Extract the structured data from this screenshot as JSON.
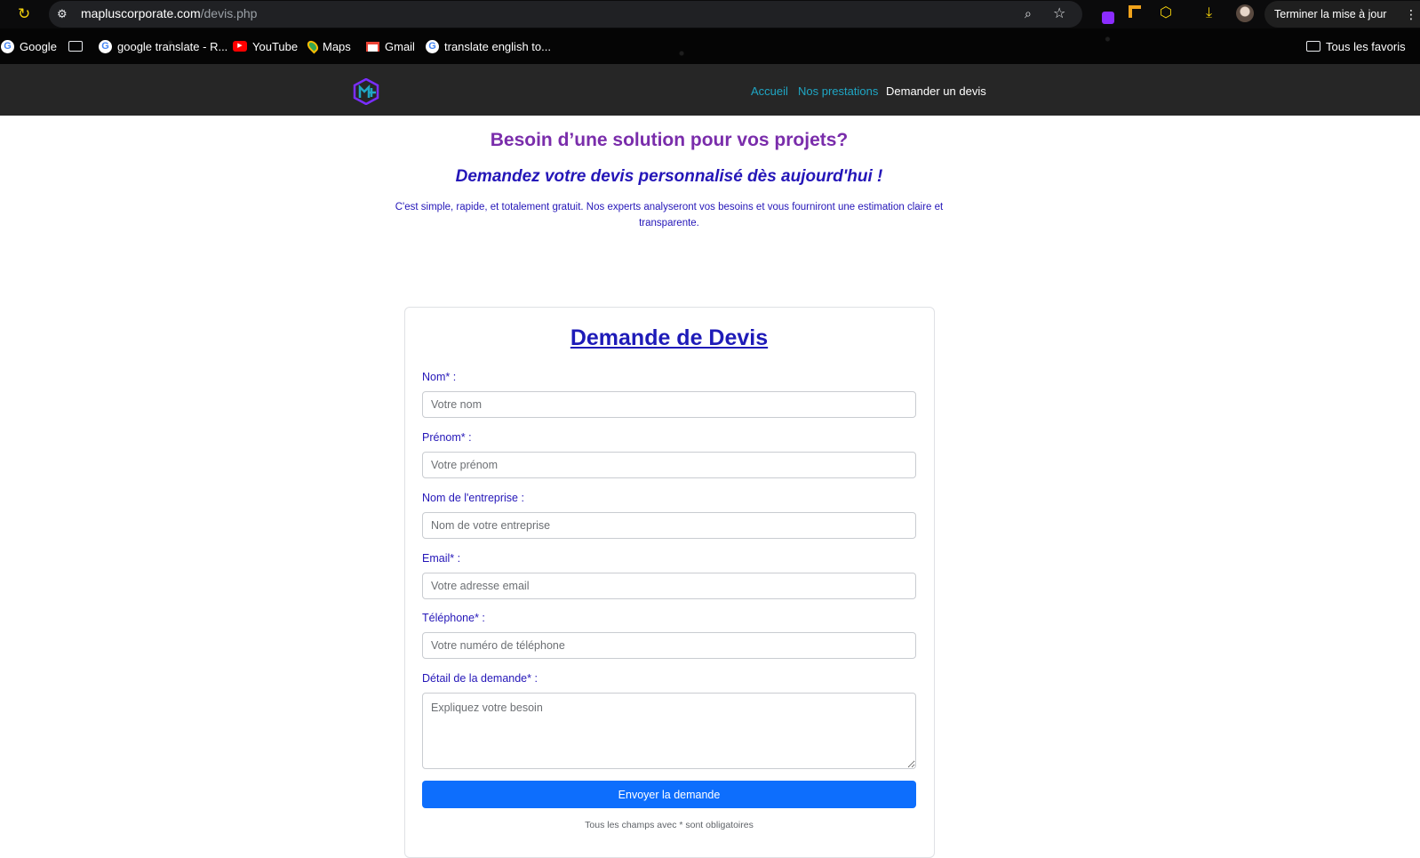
{
  "browser": {
    "url_domain": "mapluscorporate.com",
    "url_path": "/devis.php",
    "update_button": "Terminer la mise à jour",
    "bookmarks": [
      {
        "label": "Google",
        "icon": "google-icon"
      },
      {
        "label": "",
        "icon": "folder-icon"
      },
      {
        "label": "google translate - R...",
        "icon": "google-icon"
      },
      {
        "label": "YouTube",
        "icon": "youtube-icon"
      },
      {
        "label": "Maps",
        "icon": "maps-icon"
      },
      {
        "label": "Gmail",
        "icon": "gmail-icon"
      },
      {
        "label": "translate english to...",
        "icon": "google-icon"
      }
    ],
    "all_bookmarks": "Tous les favoris"
  },
  "nav": {
    "links": [
      "Accueil",
      "Nos prestations",
      "Demander un devis"
    ],
    "link_color": "#1fa6c4",
    "active_color": "#ffffff"
  },
  "hero": {
    "title": "Besoin d’une solution pour vos projets?",
    "subtitle": "Demandez votre devis personnalisé dès aujourd'hui !",
    "text": "C'est simple, rapide, et totalement gratuit. Nos experts analyseront vos besoins et vous fourniront une estimation claire et transparente."
  },
  "form": {
    "title": "Demande de Devis",
    "fields": [
      {
        "label": "Nom* :",
        "placeholder": "Votre nom"
      },
      {
        "label": "Prénom* :",
        "placeholder": "Votre prénom"
      },
      {
        "label": "Nom de l'entreprise :",
        "placeholder": "Nom de votre entreprise"
      },
      {
        "label": "Email* :",
        "placeholder": "Votre adresse email"
      },
      {
        "label": "Téléphone* :",
        "placeholder": "Votre numéro de téléphone"
      }
    ],
    "detail": {
      "label": "Détail de la demande* :",
      "placeholder": "Expliquez votre besoin"
    },
    "submit": "Envoyer la demande",
    "footnote": "Tous les champs avec * sont obligatoires",
    "accent_color": "#0d6efd"
  }
}
